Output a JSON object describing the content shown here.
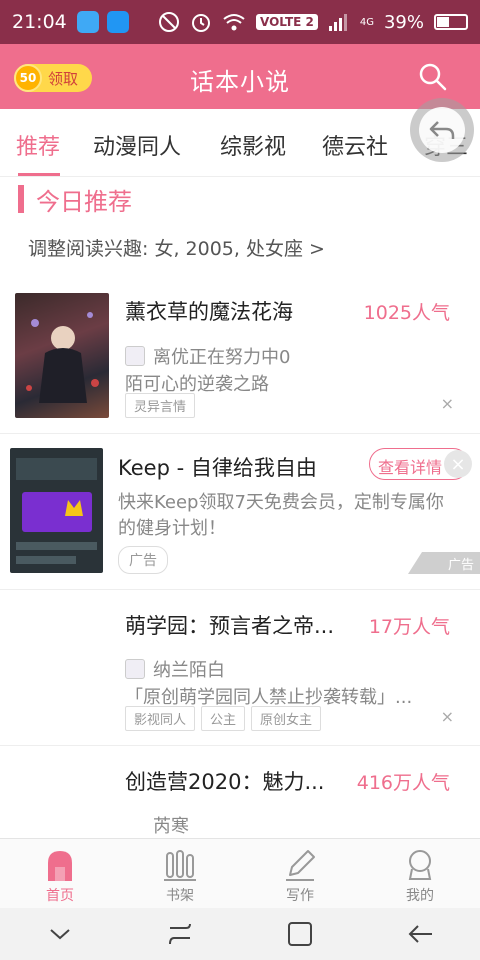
{
  "status_bar": {
    "time": "21:04",
    "volte": "VOLTE 2",
    "network": "4G",
    "battery": "39%"
  },
  "header": {
    "coin_value": "50",
    "coin_label": "领取",
    "title": "话本小说"
  },
  "tabs": [
    {
      "label": "推荐"
    },
    {
      "label": "动漫同人"
    },
    {
      "label": "综影视"
    },
    {
      "label": "德云社"
    },
    {
      "label": "穿三"
    }
  ],
  "section": {
    "title": "今日推荐",
    "prefs": "调整阅读兴趣: 女, 2005, 处女座 >"
  },
  "items": [
    {
      "title": "薰衣草的魔法花海",
      "popularity": "1025人气",
      "author": "离优正在努力中0",
      "desc": "陌可心的逆袭之路",
      "tags": [
        "灵异言情"
      ]
    },
    {
      "title": "萌学园：预言者之帝...",
      "popularity": "17万人气",
      "author": "纳兰陌白",
      "desc": "「原创萌学园同人禁止抄袭转载」...",
      "tags": [
        "影视同人",
        "公主",
        "原创女主"
      ]
    },
    {
      "title": "创造营2020：魅力...",
      "popularity": "416万人气",
      "author": "芮寒"
    }
  ],
  "ad": {
    "title": "Keep - 自律给我自由",
    "detail_button": "查看详情",
    "desc": "快来Keep领取7天免费会员，定制专属你的健身计划！",
    "tag": "广告",
    "badge": "广告"
  },
  "bottom_nav": [
    {
      "label": "首页"
    },
    {
      "label": "书架"
    },
    {
      "label": "写作"
    },
    {
      "label": "我的"
    }
  ],
  "close_symbol": "×",
  "colors": {
    "accent": "#ef6e8d",
    "status_bar": "#8a2f4a"
  }
}
